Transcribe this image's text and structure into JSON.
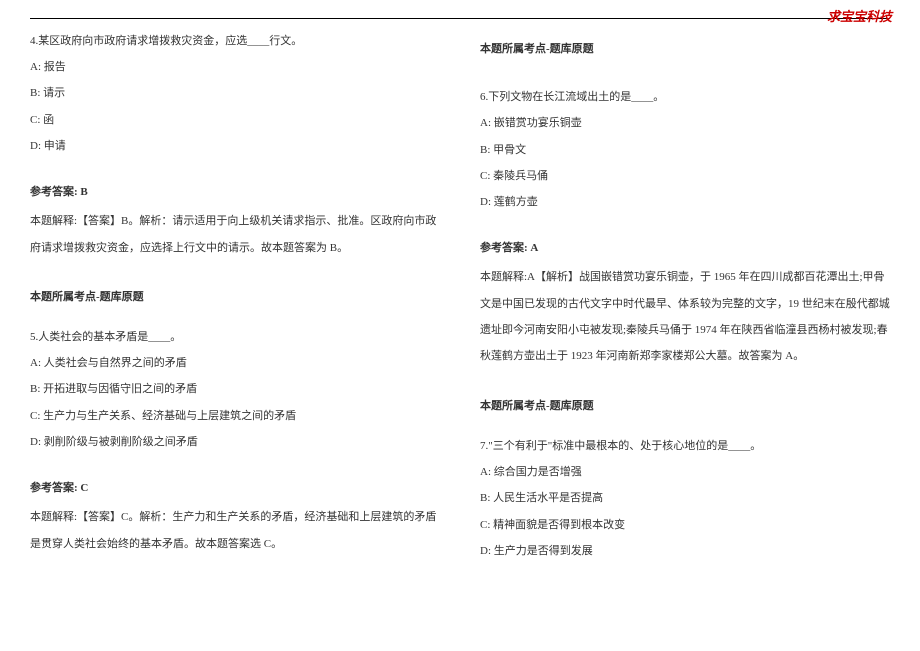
{
  "watermark": "求宝宝科技",
  "left": {
    "q4": {
      "stem": "4.某区政府向市政府请求增拨救灾资金，应选____行文。",
      "opts": {
        "A": "A: 报告",
        "B": "B: 请示",
        "C": "C: 函",
        "D": "D: 申请"
      },
      "ans_label": "参考答案: B",
      "expl": "本题解释:【答案】B。解析：请示适用于向上级机关请求指示、批准。区政府向市政府请求增拨救灾资金，应选择上行文中的请示。故本题答案为 B。",
      "point": "本题所属考点-题库原题"
    },
    "q5": {
      "stem": "5.人类社会的基本矛盾是____。",
      "opts": {
        "A": "A: 人类社会与自然界之间的矛盾",
        "B": "B: 开拓进取与因循守旧之间的矛盾",
        "C": "C: 生产力与生产关系、经济基础与上层建筑之间的矛盾",
        "D": "D: 剥削阶级与被剥削阶级之间矛盾"
      },
      "ans_label": "参考答案: C",
      "expl": "本题解释:【答案】C。解析：生产力和生产关系的矛盾，经济基础和上层建筑的矛盾是贯穿人类社会始终的基本矛盾。故本题答案选 C。"
    }
  },
  "right": {
    "point_top": "本题所属考点-题库原题",
    "q6": {
      "stem": "6.下列文物在长江流域出土的是____。",
      "opts": {
        "A": "A: 嵌错赏功宴乐铜壶",
        "B": "B: 甲骨文",
        "C": "C: 秦陵兵马俑",
        "D": "D: 莲鹤方壶"
      },
      "ans_label": "参考答案: A",
      "expl": "本题解释:A【解析】战国嵌错赏功宴乐铜壶，于 1965 年在四川成都百花潭出土;甲骨文是中国已发现的古代文字中时代最早、体系较为完整的文字，19 世纪末在殷代都城遗址即今河南安阳小屯被发现;秦陵兵马俑于 1974 年在陕西省临潼县西杨村被发现;春秋莲鹤方壶出土于 1923 年河南新郑李家楼郑公大墓。故答案为 A。",
      "point": "本题所属考点-题库原题"
    },
    "q7": {
      "stem": "7.\"三个有利于\"标准中最根本的、处于核心地位的是____。",
      "opts": {
        "A": "A: 综合国力是否增强",
        "B": "B: 人民生活水平是否提高",
        "C": "C: 精神面貌是否得到根本改变",
        "D": "D: 生产力是否得到发展"
      }
    }
  }
}
